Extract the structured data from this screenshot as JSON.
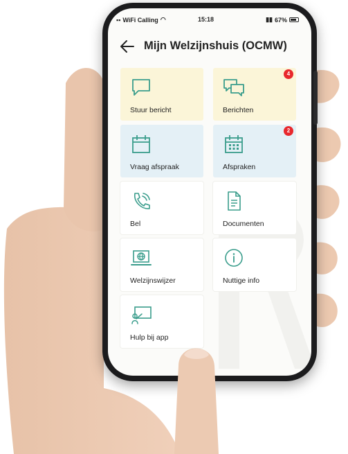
{
  "status_bar": {
    "carrier": "WiFi Calling",
    "time": "15:18",
    "battery": "67%"
  },
  "header": {
    "title": "Mijn Welzijnshuis (OCMW)"
  },
  "tiles": [
    {
      "label": "Stuur bericht",
      "icon": "chat-bubble-icon",
      "color": "#fbf5d8"
    },
    {
      "label": "Berichten",
      "icon": "chat-bubbles-icon",
      "badge": "4",
      "color": "#fbf5d8"
    },
    {
      "label": "Vraag afspraak",
      "icon": "calendar-icon",
      "color": "#e4f0f6"
    },
    {
      "label": "Afspraken",
      "icon": "calendar-grid-icon",
      "badge": "2",
      "color": "#e4f0f6"
    },
    {
      "label": "Bel",
      "icon": "phone-icon",
      "color": "#ffffff"
    },
    {
      "label": "Documenten",
      "icon": "document-icon",
      "color": "#ffffff"
    },
    {
      "label": "Welzijnswijzer",
      "icon": "laptop-globe-icon",
      "color": "#ffffff"
    },
    {
      "label": "Nuttige info",
      "icon": "info-icon",
      "color": "#ffffff"
    },
    {
      "label": "Hulp bij app",
      "icon": "presentation-icon",
      "color": "#ffffff"
    }
  ],
  "colors": {
    "accent": "#3a9d8c",
    "badge": "#e8282d"
  }
}
